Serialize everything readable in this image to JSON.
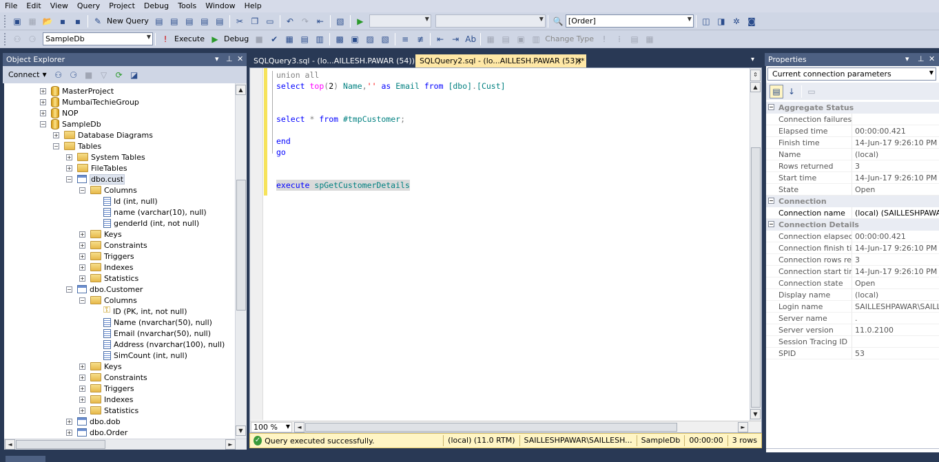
{
  "menu": [
    "File",
    "Edit",
    "View",
    "Query",
    "Project",
    "Debug",
    "Tools",
    "Window",
    "Help"
  ],
  "toolbar1": {
    "new_query_label": "New Query",
    "find_combo_value": "[Order]"
  },
  "toolbar2": {
    "database_value": "SampleDb",
    "execute_label": "Execute",
    "debug_label": "Debug",
    "change_type_label": "Change Type"
  },
  "object_explorer": {
    "title": "Object Explorer",
    "connect_label": "Connect",
    "nodes": [
      {
        "label": "MasterProject"
      },
      {
        "label": "MumbaiTechieGroup"
      },
      {
        "label": "NOP"
      },
      {
        "label": "SampleDb"
      },
      {
        "label": "Database Diagrams"
      },
      {
        "label": "Tables"
      },
      {
        "label": "System Tables"
      },
      {
        "label": "FileTables"
      },
      {
        "label": "dbo.cust"
      },
      {
        "label": "Columns"
      },
      {
        "label": "Id (int, null)"
      },
      {
        "label": "name (varchar(10), null)"
      },
      {
        "label": "genderId (int, not null)"
      },
      {
        "label": "Keys"
      },
      {
        "label": "Constraints"
      },
      {
        "label": "Triggers"
      },
      {
        "label": "Indexes"
      },
      {
        "label": "Statistics"
      },
      {
        "label": "dbo.Customer"
      },
      {
        "label": "Columns"
      },
      {
        "label": "ID (PK, int, not null)"
      },
      {
        "label": "Name (nvarchar(50), null)"
      },
      {
        "label": "Email (nvarchar(50), null)"
      },
      {
        "label": "Address (nvarchar(100), null)"
      },
      {
        "label": "SimCount (int, null)"
      },
      {
        "label": "Keys"
      },
      {
        "label": "Constraints"
      },
      {
        "label": "Triggers"
      },
      {
        "label": "Indexes"
      },
      {
        "label": "Statistics"
      },
      {
        "label": "dbo.dob"
      },
      {
        "label": "dbo.Order"
      }
    ]
  },
  "tabs": [
    {
      "label": "SQLQuery3.sql - (lo...AILLESH.PAWAR (54))"
    },
    {
      "label": "SQLQuery2.sql - (lo...AILLESH.PAWAR (53))*"
    }
  ],
  "editor": {
    "zoom": "100 %"
  },
  "status": {
    "message": "Query executed successfully.",
    "server": "(local) (11.0 RTM)",
    "user": "SAILLESHPAWAR\\SAILLESH...",
    "database": "SampleDb",
    "time": "00:00:00",
    "rows": "3 rows"
  },
  "properties": {
    "title": "Properties",
    "object": "Current connection parameters",
    "categories": [
      {
        "name": "Aggregate Status",
        "rows": [
          {
            "k": "Connection failures",
            "v": ""
          },
          {
            "k": "Elapsed time",
            "v": "00:00:00.421"
          },
          {
            "k": "Finish time",
            "v": "14-Jun-17 9:26:10 PM"
          },
          {
            "k": "Name",
            "v": "(local)"
          },
          {
            "k": "Rows returned",
            "v": "3"
          },
          {
            "k": "Start time",
            "v": "14-Jun-17 9:26:10 PM"
          },
          {
            "k": "State",
            "v": "Open"
          }
        ]
      },
      {
        "name": "Connection",
        "rows": [
          {
            "k": "Connection name",
            "v": "(local) (SAILLESHPAWAR\\S"
          }
        ]
      },
      {
        "name": "Connection Details",
        "rows": [
          {
            "k": "Connection elapsed t",
            "v": "00:00:00.421"
          },
          {
            "k": "Connection finish time",
            "v": "14-Jun-17 9:26:10 PM"
          },
          {
            "k": "Connection rows retu",
            "v": "3"
          },
          {
            "k": "Connection start time",
            "v": "14-Jun-17 9:26:10 PM"
          },
          {
            "k": "Connection state",
            "v": "Open"
          },
          {
            "k": "Display name",
            "v": "(local)"
          },
          {
            "k": "Login name",
            "v": "SAILLESHPAWAR\\SAILLES"
          },
          {
            "k": "Server name",
            "v": "."
          },
          {
            "k": "Server version",
            "v": "11.0.2100"
          },
          {
            "k": "Session Tracing ID",
            "v": ""
          },
          {
            "k": "SPID",
            "v": "53"
          }
        ]
      }
    ]
  },
  "colors": {
    "shell": "#293955",
    "pane_header": "#4d6082",
    "active_tab": "#ffe8a6",
    "status_bar": "#fff5c4",
    "keyword": "#0000ff",
    "identifier": "#008080",
    "function": "#ff00ff",
    "string": "#ff0000"
  }
}
